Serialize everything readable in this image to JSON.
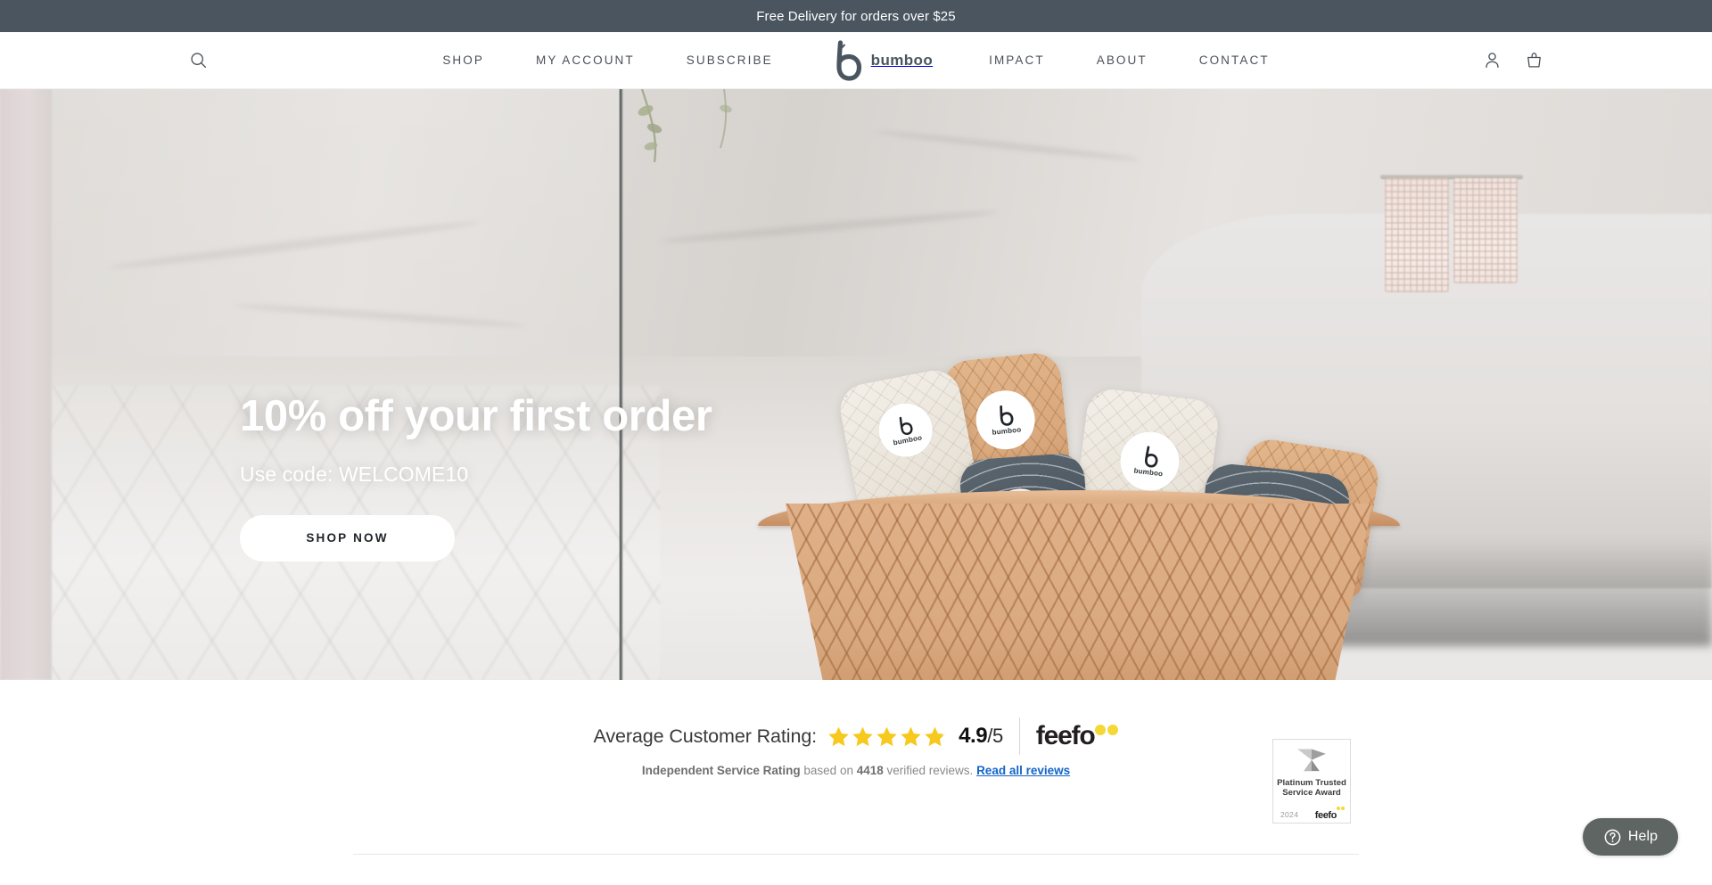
{
  "announcement": {
    "text": "Free Delivery for orders over $25"
  },
  "header": {
    "search_icon": "search-icon",
    "nav_left": [
      {
        "label": "SHOP"
      },
      {
        "label": "MY ACCOUNT"
      },
      {
        "label": "SUBSCRIBE"
      }
    ],
    "logo": {
      "mark": "bumboo-b-logo",
      "word": "bumboo"
    },
    "nav_right": [
      {
        "label": "IMPACT"
      },
      {
        "label": "ABOUT"
      },
      {
        "label": "CONTACT"
      }
    ],
    "account_icon": "user-account-icon",
    "cart_icon": "shopping-bag-icon"
  },
  "hero": {
    "heading": "10% off your first order",
    "subheading": "Use code: WELCOME10",
    "cta_label": "SHOP NOW",
    "image_alt": "basket-of-bamboo-toilet-rolls",
    "roll_badge_word": "bumboo"
  },
  "rating": {
    "label": "Average Customer Rating:",
    "stars_filled": 5,
    "score": "4.9",
    "denominator": "/5",
    "brand": "feefo",
    "detail_strong": "Independent Service Rating",
    "detail_mid": " based on ",
    "detail_count": "4418",
    "detail_tail": " verified reviews. ",
    "read_reviews_link": "Read all reviews",
    "star_color": "#f7c81e"
  },
  "award": {
    "icon": "trophy-mark-icon",
    "title_line1": "Platinum Trusted",
    "title_line2": "Service Award",
    "year": "2024",
    "brand": "feefo"
  },
  "help": {
    "icon": "question-mark-circle-icon",
    "label": "Help"
  },
  "chart_data": null
}
